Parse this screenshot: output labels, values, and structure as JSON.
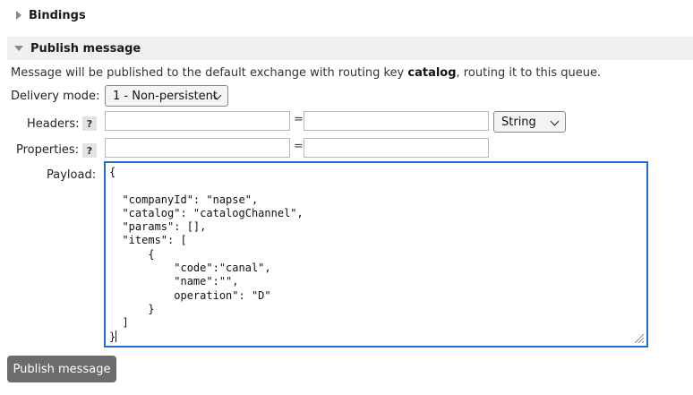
{
  "bindings": {
    "title": "Bindings"
  },
  "publish": {
    "title": "Publish message",
    "info_prefix": "Message will be published to the default exchange with routing key ",
    "routing_key": "catalog",
    "info_suffix": ", routing it to this queue.",
    "delivery_mode_label": "Delivery mode:",
    "delivery_mode_value": "1 - Non-persistent",
    "headers_label": "Headers:",
    "help_glyph": "?",
    "equals": "=",
    "header_type_value": "String",
    "properties_label": "Properties:",
    "payload_label": "Payload:",
    "payload_value": "{\n\n  \"companyId\": \"napse\",\n  \"catalog\": \"catalogChannel\",\n  \"params\": [],\n  \"items\": [\n      {\n          \"code\":\"canal\",\n          \"name\":\"\",\n          operation\": \"D\"\n      }\n  ]\n}",
    "button_label": "Publish message"
  },
  "colors": {
    "focus_border": "#1c6fd1",
    "button_bg": "#6c6c6c",
    "section_bg": "#f0f0f0"
  }
}
